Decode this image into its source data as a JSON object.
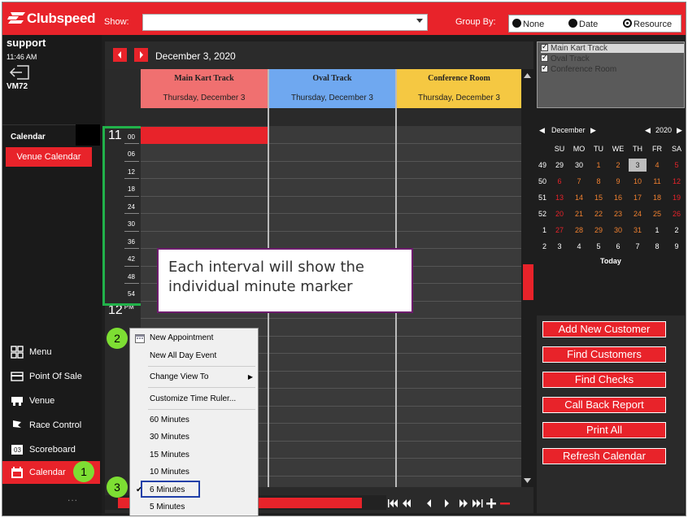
{
  "app": {
    "name": "Clubspeed"
  },
  "topbar": {
    "show_label": "Show:",
    "show_value": "",
    "groupby_label": "Group By:",
    "groupby_options": [
      "None",
      "Date",
      "Resource"
    ],
    "groupby_selected": "Resource"
  },
  "sidebar": {
    "user": "support",
    "time": "11:46 AM",
    "terminal": "VM72",
    "section": "Calendar",
    "venue_calendar": "Venue Calendar",
    "nav": [
      {
        "label": "Menu",
        "icon": "grid-icon"
      },
      {
        "label": "Point Of Sale",
        "icon": "card-icon"
      },
      {
        "label": "Venue",
        "icon": "kart-icon"
      },
      {
        "label": "Race Control",
        "icon": "flag-icon"
      },
      {
        "label": "Scoreboard",
        "icon": "scoreboard-icon"
      },
      {
        "label": "Calendar",
        "icon": "calendar-icon"
      }
    ],
    "more": "..."
  },
  "calendar": {
    "date": "December 3, 2020",
    "columns": [
      {
        "name": "Main Kart Track",
        "date": "Thursday, December 3",
        "color": "#f07070"
      },
      {
        "name": "Oval Track",
        "date": "Thursday, December 3",
        "color": "#6fa8f0"
      },
      {
        "name": "Conference Room",
        "date": "Thursday, December 3",
        "color": "#f5c842"
      }
    ],
    "ruler": {
      "hour1": "11",
      "hour1_suffix": "00",
      "minutes": [
        "06",
        "12",
        "18",
        "24",
        "30",
        "36",
        "42",
        "48",
        "54"
      ],
      "hour2": "12",
      "hour2_suffix": "PM"
    }
  },
  "callout": {
    "text": "Each interval will show the individual minute marker"
  },
  "context_menu": {
    "items": [
      "New Appointment",
      "New All Day Event",
      "Change View To",
      "Customize Time Ruler...",
      "60 Minutes",
      "30 Minutes",
      "15 Minutes",
      "10 Minutes",
      "6 Minutes",
      "5 Minutes"
    ],
    "checked": "6 Minutes"
  },
  "badges": [
    "1",
    "2",
    "3"
  ],
  "resources": [
    {
      "name": "Main Kart Track",
      "checked": true
    },
    {
      "name": "Oval Track",
      "checked": true
    },
    {
      "name": "Conference Room",
      "checked": true
    }
  ],
  "minical": {
    "month": "December",
    "year": "2020",
    "dow": [
      "SU",
      "MO",
      "TU",
      "WE",
      "TH",
      "FR",
      "SA"
    ],
    "weeks": [
      {
        "wk": "49",
        "days": [
          "29",
          "30",
          "1",
          "2",
          "3",
          "4",
          "5"
        ]
      },
      {
        "wk": "50",
        "days": [
          "6",
          "7",
          "8",
          "9",
          "10",
          "11",
          "12"
        ]
      },
      {
        "wk": "51",
        "days": [
          "13",
          "14",
          "15",
          "16",
          "17",
          "18",
          "19"
        ]
      },
      {
        "wk": "52",
        "days": [
          "20",
          "21",
          "22",
          "23",
          "24",
          "25",
          "26"
        ]
      },
      {
        "wk": "1",
        "days": [
          "27",
          "28",
          "29",
          "30",
          "31",
          "1",
          "2"
        ]
      },
      {
        "wk": "2",
        "days": [
          "3",
          "4",
          "5",
          "6",
          "7",
          "8",
          "9"
        ]
      }
    ],
    "today": "Today"
  },
  "actions": [
    "Add New Customer",
    "Find Customers",
    "Find Checks",
    "Call Back Report",
    "Print All",
    "Refresh Calendar"
  ],
  "colors": {
    "brand": "#e8232a",
    "badge": "#7dde33",
    "highlight_box": "#1f3fa8",
    "ruler_box": "#21b24a",
    "callout_border": "#6d1c6d"
  }
}
